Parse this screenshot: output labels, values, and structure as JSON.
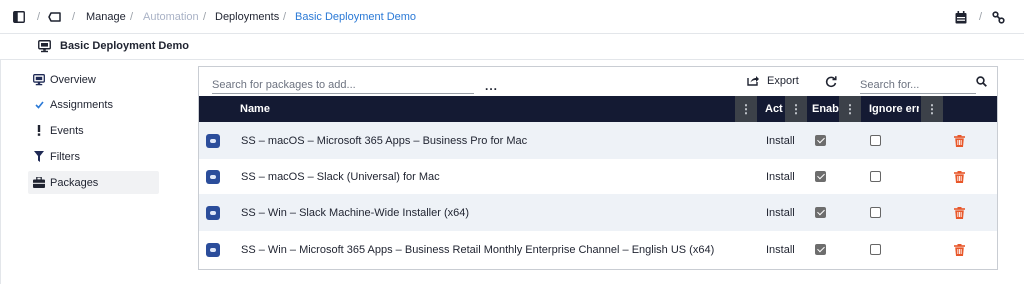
{
  "breadcrumb": {
    "sep": "/",
    "items": [
      "Manage",
      "Automation",
      "Deployments",
      "Basic Deployment Demo"
    ]
  },
  "page": {
    "title": "Basic Deployment Demo"
  },
  "sidebar": {
    "items": [
      {
        "label": "Overview",
        "icon": "monitor-icon"
      },
      {
        "label": "Assignments",
        "icon": "check-icon"
      },
      {
        "label": "Events",
        "icon": "exclamation-icon"
      },
      {
        "label": "Filters",
        "icon": "filter-icon"
      },
      {
        "label": "Packages",
        "icon": "briefcase-icon",
        "active": true
      }
    ]
  },
  "toolbar": {
    "search_packages_placeholder": "Search for packages to add...",
    "more": "...",
    "export_label": "Export",
    "search_placeholder": "Search for..."
  },
  "table": {
    "columns": [
      "Name",
      "Act",
      "Enabl",
      "Ignore erro"
    ],
    "rows": [
      {
        "name": "SS – macOS – Microsoft 365 Apps – Business Pro for Mac",
        "action": "Install",
        "enabled": true,
        "ignore_errors": false
      },
      {
        "name": "SS – macOS – Slack (Universal) for Mac",
        "action": "Install",
        "enabled": true,
        "ignore_errors": false
      },
      {
        "name": "SS – Win – Slack Machine-Wide Installer (x64)",
        "action": "Install",
        "enabled": true,
        "ignore_errors": false
      },
      {
        "name": "SS – Win – Microsoft 365 Apps – Business Retail Monthly Enterprise Channel – English US (x64)",
        "action": "Install",
        "enabled": true,
        "ignore_errors": false
      }
    ]
  },
  "colors": {
    "accent": "#2a79d6",
    "header_bg": "#141a33",
    "delete": "#e8572a"
  }
}
